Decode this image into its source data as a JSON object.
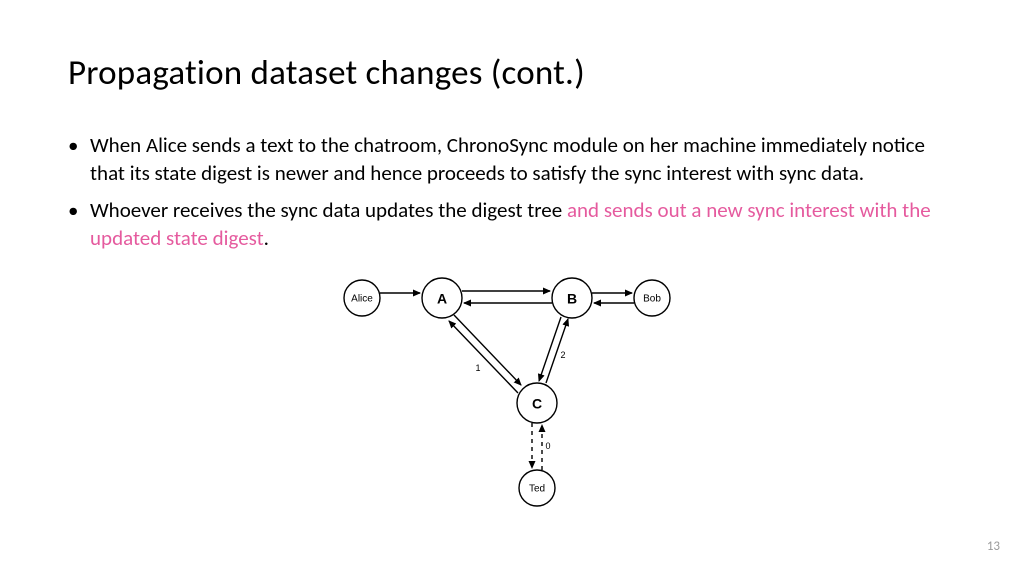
{
  "title": "Propagation dataset changes (cont.)",
  "bullets": [
    {
      "pre": "When Alice sends a text to the chatroom, ChronoSync module on her machine immediately notice that its state digest is newer and hence proceeds to satisfy the sync interest with sync data.",
      "hl": "",
      "post": ""
    },
    {
      "pre": "Whoever receives the sync data updates the digest tree ",
      "hl": "and sends out a new sync interest with the updated state digest",
      "post": "."
    }
  ],
  "diagram": {
    "nodes": {
      "alice": "Alice",
      "a": "A",
      "b": "B",
      "bob": "Bob",
      "c": "C",
      "ted": "Ted"
    },
    "edgeWeights": {
      "ac": "1",
      "bc": "2",
      "cted": "0"
    }
  },
  "pageNumber": "13"
}
